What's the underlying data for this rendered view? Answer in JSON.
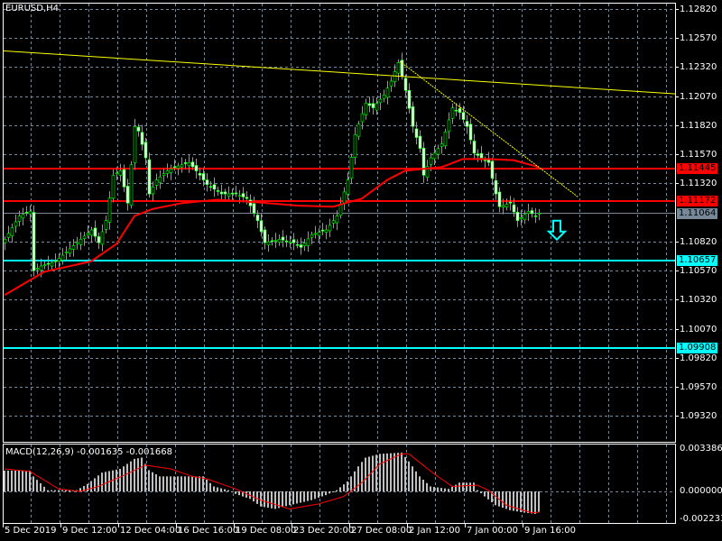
{
  "title": "EURUSD,H4",
  "chart_data": {
    "type": "candlestick",
    "symbol": "EURUSD",
    "timeframe": "H4",
    "price_axis": {
      "min": 1.0907,
      "max": 1.1282,
      "ticks": [
        "1.12820",
        "1.12570",
        "1.12320",
        "1.12070",
        "1.11820",
        "1.11570",
        "1.11320",
        "1.10820",
        "1.10570",
        "1.10320",
        "1.10070",
        "1.09820",
        "1.09570",
        "1.09320"
      ]
    },
    "time_axis": [
      "5 Dec 2019",
      "9 Dec 12:00",
      "12 Dec 04:00",
      "16 Dec 16:00",
      "19 Dec 08:00",
      "23 Dec 20:00",
      "27 Dec 08:00",
      "2 Jan 12:00",
      "7 Jan 00:00",
      "9 Jan 16:00"
    ],
    "bar_count": 149,
    "close_keypoints": [
      [
        0,
        1.1084
      ],
      [
        4,
        1.1104
      ],
      [
        7,
        1.1108
      ],
      [
        8,
        1.1057
      ],
      [
        10,
        1.1061
      ],
      [
        14,
        1.1065
      ],
      [
        17,
        1.1073
      ],
      [
        21,
        1.1084
      ],
      [
        24,
        1.1092
      ],
      [
        26,
        1.1081
      ],
      [
        28,
        1.11
      ],
      [
        30,
        1.1139
      ],
      [
        32,
        1.1143
      ],
      [
        34,
        1.1115
      ],
      [
        36,
        1.1181
      ],
      [
        37,
        1.1177
      ],
      [
        39,
        1.1154
      ],
      [
        40,
        1.1123
      ],
      [
        42,
        1.1135
      ],
      [
        45,
        1.1143
      ],
      [
        47,
        1.1146
      ],
      [
        51,
        1.115
      ],
      [
        54,
        1.1139
      ],
      [
        56,
        1.1131
      ],
      [
        60,
        1.1123
      ],
      [
        64,
        1.1123
      ],
      [
        67,
        1.1119
      ],
      [
        70,
        1.11
      ],
      [
        72,
        1.1081
      ],
      [
        76,
        1.1084
      ],
      [
        80,
        1.1081
      ],
      [
        82,
        1.1077
      ],
      [
        85,
        1.1088
      ],
      [
        89,
        1.1092
      ],
      [
        92,
        1.1104
      ],
      [
        95,
        1.1135
      ],
      [
        97,
        1.1174
      ],
      [
        100,
        1.1201
      ],
      [
        102,
        1.1197
      ],
      [
        105,
        1.1208
      ],
      [
        107,
        1.122
      ],
      [
        109,
        1.1236
      ],
      [
        111,
        1.1212
      ],
      [
        113,
        1.1181
      ],
      [
        115,
        1.1162
      ],
      [
        116,
        1.1139
      ],
      [
        118,
        1.1154
      ],
      [
        121,
        1.1166
      ],
      [
        124,
        1.1197
      ],
      [
        126,
        1.1193
      ],
      [
        128,
        1.1181
      ],
      [
        130,
        1.1158
      ],
      [
        132,
        1.1154
      ],
      [
        134,
        1.115
      ],
      [
        136,
        1.1123
      ],
      [
        137,
        1.1112
      ],
      [
        140,
        1.1115
      ],
      [
        142,
        1.11
      ],
      [
        145,
        1.1108
      ],
      [
        147,
        1.1104
      ],
      [
        148,
        1.11064
      ]
    ],
    "moving_average": [
      [
        0,
        1.1036
      ],
      [
        11,
        1.1056
      ],
      [
        24,
        1.1065
      ],
      [
        31,
        1.108
      ],
      [
        36,
        1.1104
      ],
      [
        41,
        1.111
      ],
      [
        49,
        1.1115
      ],
      [
        59,
        1.1118
      ],
      [
        69,
        1.1116
      ],
      [
        81,
        1.1113
      ],
      [
        91,
        1.1112
      ],
      [
        99,
        1.1119
      ],
      [
        106,
        1.1135
      ],
      [
        111,
        1.1143
      ],
      [
        121,
        1.1146
      ],
      [
        127,
        1.1153
      ],
      [
        134,
        1.1153
      ],
      [
        141,
        1.1152
      ],
      [
        148,
        1.1146
      ]
    ],
    "trendlines": [
      {
        "from": [
          -0.5,
          1.1246
        ],
        "to": [
          186,
          1.1209
        ],
        "color": "#ffff00",
        "style": "solid"
      },
      {
        "from": [
          109.5,
          1.1237
        ],
        "to": [
          159,
          1.112
        ],
        "color": "#ffff00",
        "style": "dotted"
      }
    ],
    "levels": [
      {
        "price": "1.11445",
        "color": "#ff0000",
        "text_color": "#000000"
      },
      {
        "price": "1.11172",
        "color": "#ff0000",
        "text_color": "#000000"
      },
      {
        "price": "1.10657",
        "color": "#00ffff",
        "text_color": "#000000"
      },
      {
        "price": "1.09908",
        "color": "#00ffff",
        "text_color": "#000000"
      }
    ],
    "current_price": {
      "price": "1.11064",
      "color": "#778899"
    },
    "signal_arrow": {
      "direction": "down",
      "bar": 153,
      "price": 1.11,
      "color": "#00ffff"
    },
    "macd": {
      "label": "MACD(12,26,9) -0.001635 -0.001668",
      "ticks": [
        "0.003386",
        "0.000000",
        "-0.002233"
      ],
      "max": 0.003386,
      "min": -0.002233,
      "histogram_keypoints": [
        [
          0,
          0.00166
        ],
        [
          7,
          0.00166
        ],
        [
          8,
          0.0012
        ],
        [
          12,
          0.0001
        ],
        [
          20,
          0.0001
        ],
        [
          23,
          0.0006
        ],
        [
          27,
          0.0015
        ],
        [
          32,
          0.0018
        ],
        [
          36,
          0.0026
        ],
        [
          38,
          0.0027
        ],
        [
          40,
          0.0017
        ],
        [
          43,
          0.0012
        ],
        [
          48,
          0.0012
        ],
        [
          55,
          0.0012
        ],
        [
          58,
          0.0004
        ],
        [
          62,
          0.0001
        ],
        [
          64,
          -0.0002
        ],
        [
          68,
          -0.0006
        ],
        [
          71,
          -0.0012
        ],
        [
          75,
          -0.0014
        ],
        [
          79,
          -0.0011
        ],
        [
          85,
          -0.0007
        ],
        [
          89,
          -0.0003
        ],
        [
          92,
          0.0001
        ],
        [
          95,
          0.0008
        ],
        [
          98,
          0.002
        ],
        [
          100,
          0.0027
        ],
        [
          104,
          0.003
        ],
        [
          110,
          0.0031
        ],
        [
          112,
          0.0024
        ],
        [
          115,
          0.0012
        ],
        [
          118,
          0.0004
        ],
        [
          123,
          0.0002
        ],
        [
          126,
          0.0007
        ],
        [
          130,
          0.0007
        ],
        [
          131,
          0.0001
        ],
        [
          133,
          -0.0004
        ],
        [
          136,
          -0.0011
        ],
        [
          140,
          -0.0015
        ],
        [
          144,
          -0.0017
        ],
        [
          147,
          -0.0018
        ],
        [
          148,
          -0.001635
        ]
      ],
      "signal_keypoints": [
        [
          0,
          0.0018
        ],
        [
          7,
          0.0016
        ],
        [
          15,
          0.0002
        ],
        [
          21,
          0
        ],
        [
          26,
          0.0004
        ],
        [
          34,
          0.0014
        ],
        [
          39,
          0.0021
        ],
        [
          46,
          0.0018
        ],
        [
          52,
          0.0012
        ],
        [
          56,
          0.001
        ],
        [
          64,
          0.0002
        ],
        [
          71,
          -0.0007
        ],
        [
          79,
          -0.0014
        ],
        [
          87,
          -0.001
        ],
        [
          94,
          -0.0004
        ],
        [
          99,
          0.0007
        ],
        [
          104,
          0.0022
        ],
        [
          110,
          0.003
        ],
        [
          112,
          0.003
        ],
        [
          119,
          0.0014
        ],
        [
          124,
          0.0004
        ],
        [
          131,
          0.0005
        ],
        [
          134,
          0.0001
        ],
        [
          139,
          -0.0011
        ],
        [
          146,
          -0.0017
        ],
        [
          148,
          -0.001668
        ]
      ]
    },
    "colors": {
      "grid": "#778899",
      "bull_wick": "#00ff00",
      "bear_body": "#ffffff",
      "ma": "#ff0000",
      "hist": "#c0c0c0",
      "signal": "#ff0000"
    }
  }
}
